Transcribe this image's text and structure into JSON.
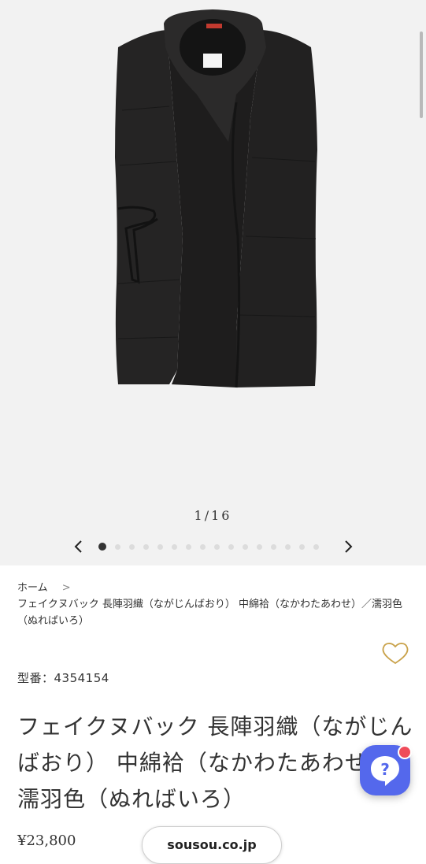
{
  "gallery": {
    "counter": "1/16",
    "total_slides": 16,
    "current_slide": 1
  },
  "breadcrumb": {
    "home": "ホーム",
    "separator": ">",
    "current": "フェイクヌバック 長陣羽織（ながじんばおり） 中綿袷（なかわたあわせ）／濡羽色（ぬればいろ）"
  },
  "product": {
    "model_number": "型番：4354154",
    "title": "フェイクヌバック 長陣羽織（ながじんばおり） 中綿袷（なかわたあわせ）／濡羽色（ぬればいろ）",
    "price": "¥23,800"
  },
  "site_pill": {
    "label": "sousou.co.jp"
  },
  "help": {
    "label": "?"
  },
  "colors": {
    "gallery_bg": "#f2f2f2",
    "help_button": "#5468ec",
    "badge": "#ef4b5a",
    "heart": "#c9a24a"
  },
  "icons": [
    "chevron-left-icon",
    "chevron-right-icon",
    "heart-icon",
    "question-icon"
  ]
}
